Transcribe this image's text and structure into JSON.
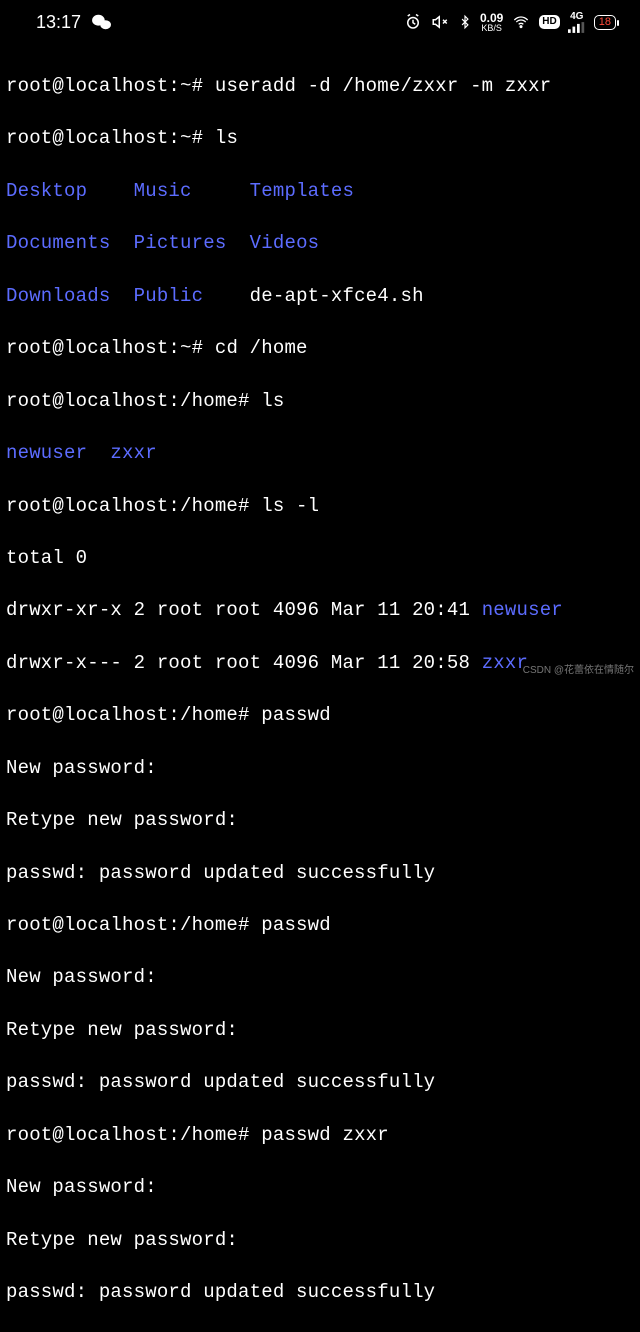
{
  "status": {
    "time": "13:17",
    "net_speed_value": "0.09",
    "net_speed_unit": "KB/S",
    "hd_label": "HD",
    "cell_label": "4G",
    "battery_pct": "18"
  },
  "terminal": {
    "p_home": "root@localhost:~# ",
    "p_home_dir": "root@localhost:/home# ",
    "cmd_useradd": "useradd -d /home/zxxr -m zxxr",
    "cmd_ls": "ls",
    "cmd_cd_home": "cd /home",
    "cmd_ls_l": "ls -l",
    "cmd_passwd": "passwd",
    "cmd_passwd_zxxr": "passwd zxxr",
    "ls_cols": {
      "c0r0": "Desktop    ",
      "c1r0": "Music     ",
      "c2r0": "Templates",
      "c0r1": "Documents  ",
      "c1r1": "Pictures  ",
      "c2r1": "Videos",
      "c0r2": "Downloads  ",
      "c1r2": "Public    ",
      "c2r2": "de-apt-xfce4.sh"
    },
    "home_ls": {
      "a": "newuser  ",
      "b": "zxxr"
    },
    "total": "total 0",
    "lsl1_pre": "drwxr-xr-x 2 root root 4096 Mar 11 20:41 ",
    "lsl1_name": "newuser",
    "lsl2_pre": "drwxr-x--- 2 root root 4096 Mar 11 20:58 ",
    "lsl2_name": "zxxr",
    "newpwd": "New password:",
    "retypepwd": "Retype new password:",
    "pwd_ok": "passwd: password updated successfully"
  },
  "watermark": "CSDN @花蕾依在情随尔"
}
